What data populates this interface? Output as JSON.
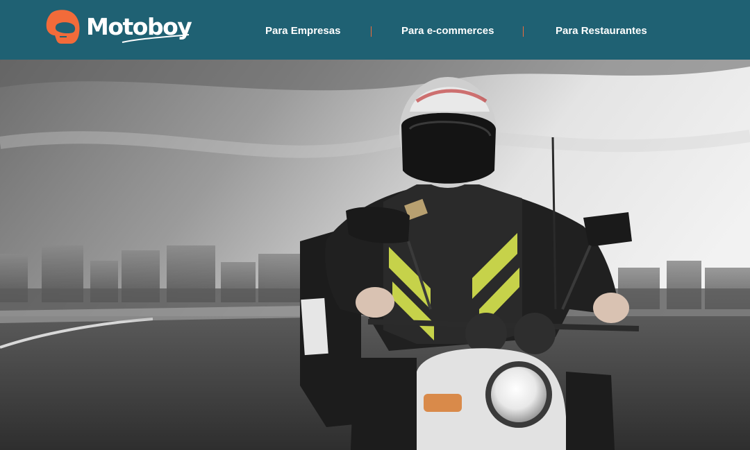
{
  "brand": {
    "name": "Motoboy",
    "accent_color": "#f26b3a",
    "header_color": "#1f6173",
    "icon": "helmet-logo-icon"
  },
  "nav": {
    "items": [
      {
        "label": "Para Empresas"
      },
      {
        "label": "Para e-commerces"
      },
      {
        "label": "Para Restaurantes"
      }
    ]
  },
  "hero": {
    "image": "motorcycle-courier-photo"
  }
}
